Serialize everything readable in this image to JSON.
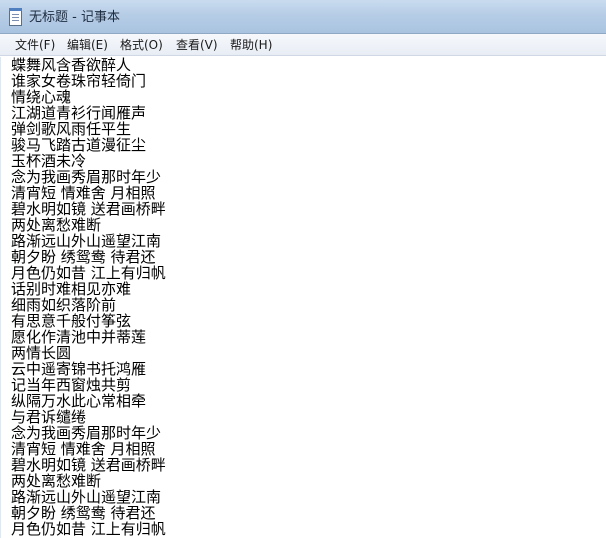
{
  "window": {
    "title": "无标题 - 记事本"
  },
  "icons": {
    "app": "notepad-icon"
  },
  "menu": {
    "file": "文件(F)",
    "edit": "编辑(E)",
    "format": "格式(O)",
    "view": "查看(V)",
    "help": "帮助(H)"
  },
  "document": {
    "lines": [
      "蝶舞风含香欲醉人",
      "谁家女卷珠帘轻倚门",
      "情绕心魂",
      "江湖道青衫行闻雁声",
      "弹剑歌风雨任平生",
      "骏马飞踏古道漫征尘",
      "玉杯酒未冷",
      "念为我画秀眉那时年少",
      "清宵短 情难舍 月相照",
      "碧水明如镜 送君画桥畔",
      "两处离愁难断",
      "路渐远山外山遥望江南",
      "朝夕盼 绣鸳鸯 待君还",
      "月色仍如昔 江上有归帆",
      "话别时难相见亦难",
      "细雨如织落阶前",
      "有思意千般付筝弦",
      "愿化作清池中并蒂莲",
      "两情长圆",
      "云中遥寄锦书托鸿雁",
      "记当年西窗烛共剪",
      "纵隔万水此心常相牵",
      "与君诉缱绻",
      "念为我画秀眉那时年少",
      "清宵短 情难舍 月相照",
      "碧水明如镜 送君画桥畔",
      "两处离愁难断",
      "路渐远山外山遥望江南",
      "朝夕盼 绣鸳鸯 待君还",
      "月色仍如昔 江上有归帆"
    ]
  }
}
